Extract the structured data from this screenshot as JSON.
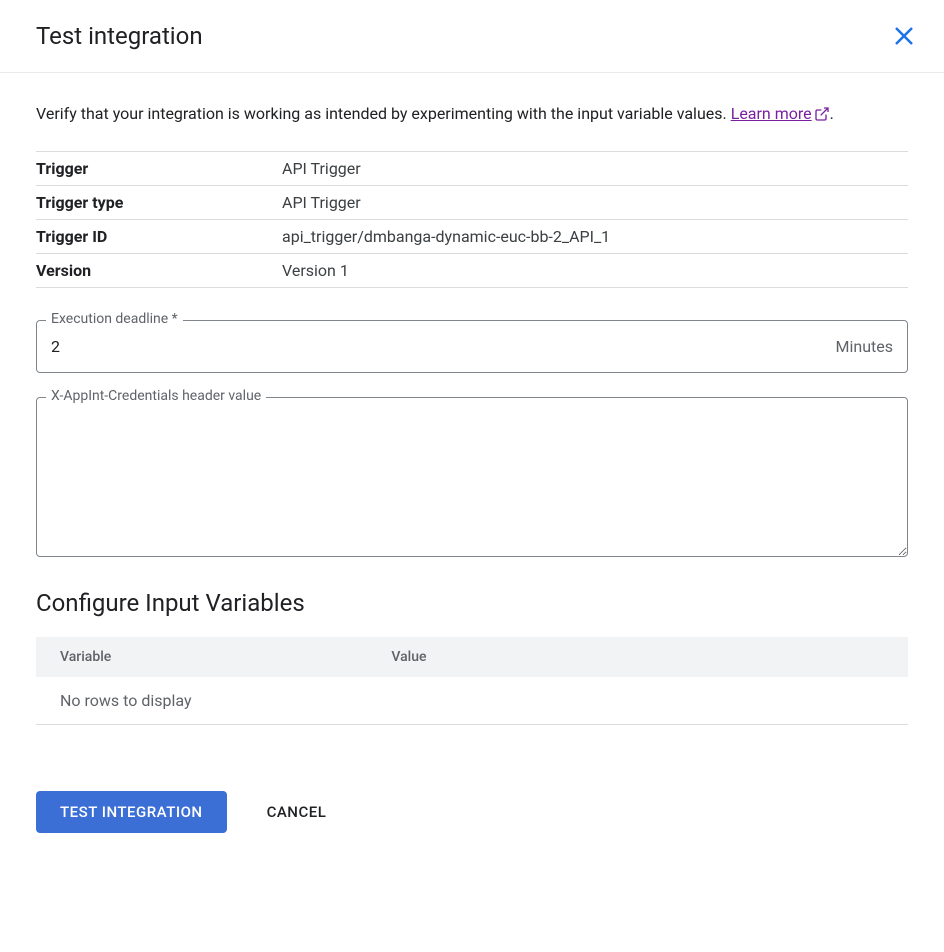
{
  "dialog": {
    "title": "Test integration",
    "description_prefix": "Verify that your integration is working as intended by experimenting with the input variable values. ",
    "learn_more_label": "Learn more",
    "description_suffix": "."
  },
  "info": {
    "trigger_label": "Trigger",
    "trigger_value": "API Trigger",
    "trigger_type_label": "Trigger type",
    "trigger_type_value": "API Trigger",
    "trigger_id_label": "Trigger ID",
    "trigger_id_value": "api_trigger/dmbanga-dynamic-euc-bb-2_API_1",
    "version_label": "Version",
    "version_value": "Version 1"
  },
  "fields": {
    "execution_deadline_label": "Execution deadline *",
    "execution_deadline_value": "2",
    "execution_deadline_unit": "Minutes",
    "credentials_header_label": "X-AppInt-Credentials header value",
    "credentials_header_value": ""
  },
  "vars_section": {
    "title": "Configure Input Variables",
    "col_variable": "Variable",
    "col_value": "Value",
    "empty_message": "No rows to display"
  },
  "footer": {
    "primary_button": "Test Integration",
    "cancel_button": "Cancel"
  }
}
